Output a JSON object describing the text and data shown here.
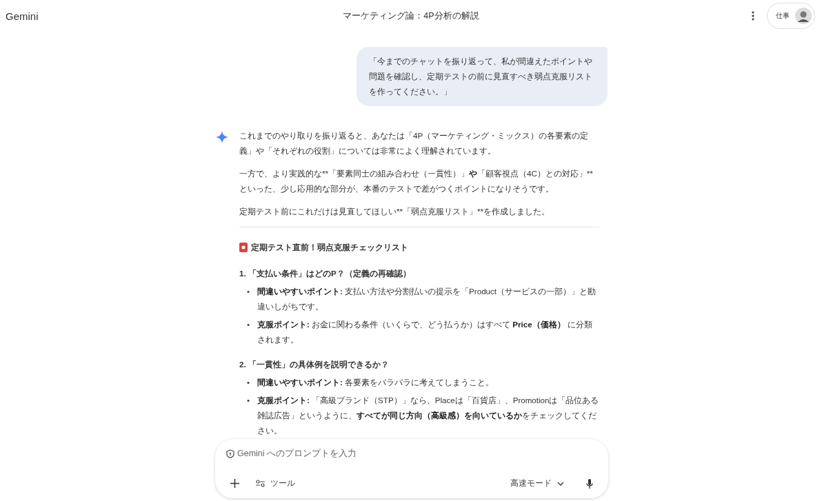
{
  "app_name": "Gemini",
  "conversation_title": "マーケティング論：4P分析の解説",
  "account": {
    "label": "仕事"
  },
  "user_message": "「今までのチャットを振り返って、私が間違えたポイントや問題を確認し、定期テストの前に見直すべき弱点克服リストを作ってください。」",
  "response": {
    "paragraphs": [
      [
        {
          "text": "これまでのやり取りを振り返ると、あなたは「4P（マーケティング・ミックス）の各要素の定義」や「それぞれの役割」については非常によく理解されています。",
          "bold": false
        }
      ],
      [
        {
          "text": "一方で、より実践的な**「要素同士の組み合わせ（一貫性）」",
          "bold": false
        },
        {
          "text": "や",
          "bold": true
        },
        {
          "text": "「顧客視点（4C）との対応」**といった、少し応用的な部分が、本番のテストで差がつくポイントになりそうです。",
          "bold": false
        }
      ],
      [
        {
          "text": "定期テスト前にこれだけは見直してほしい**「弱点克服リスト」**を作成しました。",
          "bold": false
        }
      ]
    ],
    "checklist_title": "定期テスト直前！弱点克服チェックリスト",
    "sections": [
      {
        "heading": "1. 「支払い条件」はどのP？（定義の再確認）",
        "bullets": [
          {
            "marker": "•",
            "segments": [
              {
                "text": "間違いやすいポイント:",
                "bold": true
              },
              {
                "text": " 支払い方法や分割払いの提示を「Product（サービスの一部）」と勘違いしがちです。",
                "bold": false
              }
            ]
          },
          {
            "marker": "•",
            "segments": [
              {
                "text": "克服ポイント:",
                "bold": true
              },
              {
                "text": " お金に関わる条件（いくらで、どう払うか）はすべて ",
                "bold": false
              },
              {
                "text": "Price（価格）",
                "bold": true
              },
              {
                "text": " に分類されます。",
                "bold": false
              }
            ]
          }
        ]
      },
      {
        "heading": "2. 「一貫性」の具体例を説明できるか？",
        "bullets": [
          {
            "marker": "•",
            "segments": [
              {
                "text": "間違いやすいポイント:",
                "bold": true
              },
              {
                "text": " 各要素をバラバラに考えてしまうこと。",
                "bold": false
              }
            ]
          },
          {
            "marker": "•",
            "segments": [
              {
                "text": "克服ポイント:",
                "bold": true
              },
              {
                "text": " 「高級ブランド（STP）」なら、Placeは「百貨店」、Promotionは「品位ある雑誌広告」というように、",
                "bold": false
              },
              {
                "text": "すべてが同じ方向（高級感）を向いているか",
                "bold": true
              },
              {
                "text": "をチェックしてください。",
                "bold": false
              }
            ]
          }
        ]
      }
    ]
  },
  "prompt": {
    "placeholder": "Gemini へのプロンプトを入力",
    "tools_label": "ツール",
    "mode_label": "高速モード"
  }
}
